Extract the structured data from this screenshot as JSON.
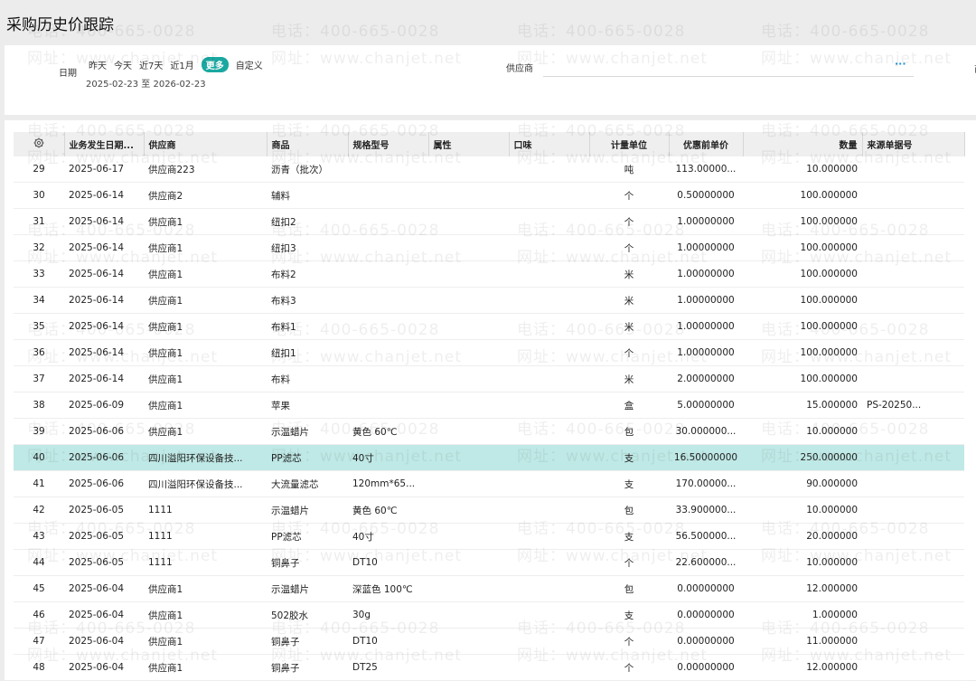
{
  "page_title": "采购历史价跟踪",
  "filters": {
    "date_label": "日期",
    "quick_dates": [
      "昨天",
      "今天",
      "近7天",
      "近1月"
    ],
    "more_label": "更多",
    "custom_label": "自定义",
    "date_range": "2025-02-23 至 2026-02-23",
    "supplier_label": "供应商",
    "supplier_value": "",
    "supplier_more": "···",
    "edge_text": "商"
  },
  "watermark": {
    "phone": "电话：400-665-0028",
    "site": "网址：www.chanjet.net"
  },
  "table": {
    "settings_icon": "gear-icon",
    "columns": [
      "业务发生日期...",
      "供应商",
      "商品",
      "规格型号",
      "属性",
      "口味",
      "计量单位",
      "优惠前单价",
      "数量",
      "来源单据号"
    ],
    "rows": [
      {
        "no": "29",
        "date": "2025-06-17",
        "supplier": "供应商223",
        "product": "沥青（批次）",
        "spec": "",
        "attr": "",
        "flavor": "",
        "unit": "吨",
        "price": "113.00000...",
        "qty": "10.000000",
        "source": ""
      },
      {
        "no": "30",
        "date": "2025-06-14",
        "supplier": "供应商2",
        "product": "辅料",
        "spec": "",
        "attr": "",
        "flavor": "",
        "unit": "个",
        "price": "0.50000000",
        "qty": "100.000000",
        "source": ""
      },
      {
        "no": "31",
        "date": "2025-06-14",
        "supplier": "供应商1",
        "product": "纽扣2",
        "spec": "",
        "attr": "",
        "flavor": "",
        "unit": "个",
        "price": "1.00000000",
        "qty": "100.000000",
        "source": ""
      },
      {
        "no": "32",
        "date": "2025-06-14",
        "supplier": "供应商1",
        "product": "纽扣3",
        "spec": "",
        "attr": "",
        "flavor": "",
        "unit": "个",
        "price": "1.00000000",
        "qty": "100.000000",
        "source": ""
      },
      {
        "no": "33",
        "date": "2025-06-14",
        "supplier": "供应商1",
        "product": "布料2",
        "spec": "",
        "attr": "",
        "flavor": "",
        "unit": "米",
        "price": "1.00000000",
        "qty": "100.000000",
        "source": ""
      },
      {
        "no": "34",
        "date": "2025-06-14",
        "supplier": "供应商1",
        "product": "布料3",
        "spec": "",
        "attr": "",
        "flavor": "",
        "unit": "米",
        "price": "1.00000000",
        "qty": "100.000000",
        "source": ""
      },
      {
        "no": "35",
        "date": "2025-06-14",
        "supplier": "供应商1",
        "product": "布料1",
        "spec": "",
        "attr": "",
        "flavor": "",
        "unit": "米",
        "price": "1.00000000",
        "qty": "100.000000",
        "source": ""
      },
      {
        "no": "36",
        "date": "2025-06-14",
        "supplier": "供应商1",
        "product": "纽扣1",
        "spec": "",
        "attr": "",
        "flavor": "",
        "unit": "个",
        "price": "1.00000000",
        "qty": "100.000000",
        "source": ""
      },
      {
        "no": "37",
        "date": "2025-06-14",
        "supplier": "供应商1",
        "product": "布料",
        "spec": "",
        "attr": "",
        "flavor": "",
        "unit": "米",
        "price": "2.00000000",
        "qty": "100.000000",
        "source": ""
      },
      {
        "no": "38",
        "date": "2025-06-09",
        "supplier": "供应商1",
        "product": "苹果",
        "spec": "",
        "attr": "",
        "flavor": "",
        "unit": "盒",
        "price": "5.00000000",
        "qty": "15.000000",
        "source": "PS-20250..."
      },
      {
        "no": "39",
        "date": "2025-06-06",
        "supplier": "供应商1",
        "product": "示温蜡片",
        "spec": "黄色 60℃",
        "attr": "",
        "flavor": "",
        "unit": "包",
        "price": "30.000000...",
        "qty": "10.000000",
        "source": ""
      },
      {
        "no": "40",
        "date": "2025-06-06",
        "supplier": "四川溢阳环保设备技...",
        "product": "PP滤芯",
        "spec": "40寸",
        "attr": "",
        "flavor": "",
        "unit": "支",
        "price": "16.50000000",
        "qty": "250.000000",
        "source": "",
        "selected": true
      },
      {
        "no": "41",
        "date": "2025-06-06",
        "supplier": "四川溢阳环保设备技...",
        "product": "大流量滤芯",
        "spec": "120mm*65...",
        "attr": "",
        "flavor": "",
        "unit": "支",
        "price": "170.00000...",
        "qty": "90.000000",
        "source": ""
      },
      {
        "no": "42",
        "date": "2025-06-05",
        "supplier": "1111",
        "product": "示温蜡片",
        "spec": "黄色 60℃",
        "attr": "",
        "flavor": "",
        "unit": "包",
        "price": "33.900000...",
        "qty": "10.000000",
        "source": ""
      },
      {
        "no": "43",
        "date": "2025-06-05",
        "supplier": "1111",
        "product": "PP滤芯",
        "spec": "40寸",
        "attr": "",
        "flavor": "",
        "unit": "支",
        "price": "56.500000...",
        "qty": "20.000000",
        "source": ""
      },
      {
        "no": "44",
        "date": "2025-06-05",
        "supplier": "1111",
        "product": "铜鼻子",
        "spec": "DT10",
        "attr": "",
        "flavor": "",
        "unit": "个",
        "price": "22.600000...",
        "qty": "10.000000",
        "source": ""
      },
      {
        "no": "45",
        "date": "2025-06-04",
        "supplier": "供应商1",
        "product": "示温蜡片",
        "spec": "深蓝色 100℃",
        "attr": "",
        "flavor": "",
        "unit": "包",
        "price": "0.00000000",
        "qty": "12.000000",
        "source": ""
      },
      {
        "no": "46",
        "date": "2025-06-04",
        "supplier": "供应商1",
        "product": "502胶水",
        "spec": "30g",
        "attr": "",
        "flavor": "",
        "unit": "支",
        "price": "0.00000000",
        "qty": "1.000000",
        "source": ""
      },
      {
        "no": "47",
        "date": "2025-06-04",
        "supplier": "供应商1",
        "product": "铜鼻子",
        "spec": "DT10",
        "attr": "",
        "flavor": "",
        "unit": "个",
        "price": "0.00000000",
        "qty": "11.000000",
        "source": ""
      },
      {
        "no": "48",
        "date": "2025-06-04",
        "supplier": "供应商1",
        "product": "铜鼻子",
        "spec": "DT25",
        "attr": "",
        "flavor": "",
        "unit": "个",
        "price": "0.00000000",
        "qty": "12.000000",
        "source": ""
      }
    ]
  },
  "colors": {
    "accent": "#1aa8a0",
    "selected_row": "#bfe9e6",
    "header_bg": "#efefef"
  }
}
